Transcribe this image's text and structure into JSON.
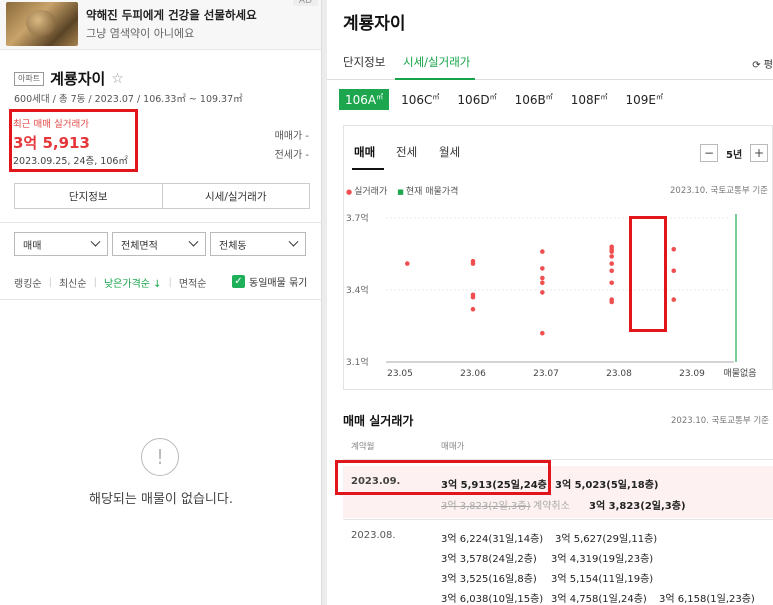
{
  "ad": {
    "title": "약해진 두피에게 건강을 선물하세요",
    "subtitle": "그냥 염색약이 아니에요",
    "badge": "AD"
  },
  "complex": {
    "type_tag": "아파트",
    "name": "계룡자이",
    "star": "☆",
    "info": "600세대 / 총 7동 / 2023.07 / 106.33㎡ ~ 109.37㎡"
  },
  "recent_deal": {
    "label": "최근 매매 실거래가",
    "price": "3억 5,913",
    "detail": "2023.09.25, 24층, 106㎡",
    "sale_label": "매매가 -",
    "jeonse_label": "전세가 -"
  },
  "left_tabs": [
    "단지정보",
    "시세/실거래가"
  ],
  "filters": [
    {
      "value": "매매"
    },
    {
      "value": "전체면적"
    },
    {
      "value": "전체동"
    }
  ],
  "sort": {
    "items": [
      "랭킹순",
      "최신순",
      "낮은가격순 ↓",
      "면적순"
    ],
    "active_index": 2,
    "checkbox_label": "동일매물 묶기",
    "checked": true
  },
  "empty": {
    "icon": "!",
    "message": "해당되는 매물이 없습니다."
  },
  "right": {
    "title": "계룡자이",
    "tabs": [
      "단지정보",
      "시세/실거래가"
    ],
    "active_tab": 1,
    "refresh_label": "⟳ 평",
    "sizes": [
      "106A",
      "106C",
      "106D",
      "106B",
      "108F",
      "109E"
    ],
    "size_unit": "㎡",
    "active_size": 0
  },
  "chart_panel": {
    "tabs": [
      "매매",
      "전세",
      "월세"
    ],
    "active_tab": 0,
    "period": "5년",
    "minus": "−",
    "plus": "+",
    "legend_real": "실거래가",
    "legend_listing": "현재 매물가격",
    "source": "2023.10. 국토교통부 기준"
  },
  "chart_data": {
    "type": "scatter",
    "x_ticks": [
      "23.05",
      "23.06",
      "23.07",
      "23.08",
      "23.09"
    ],
    "extra_x_label": "매물없음",
    "y_ticks": [
      "3.1억",
      "3.4억",
      "3.7억"
    ],
    "y_tick_values": [
      3.1,
      3.4,
      3.7
    ],
    "ylim": [
      3.1,
      3.7
    ],
    "series": [
      {
        "color": "#f04f4f",
        "points": [
          {
            "x": 0.1,
            "y": 3.51
          },
          {
            "x": 1.0,
            "y": 3.52
          },
          {
            "x": 1.0,
            "y": 3.51
          },
          {
            "x": 1.0,
            "y": 3.38
          },
          {
            "x": 1.0,
            "y": 3.37
          },
          {
            "x": 1.0,
            "y": 3.32
          },
          {
            "x": 1.95,
            "y": 3.56
          },
          {
            "x": 1.95,
            "y": 3.49
          },
          {
            "x": 1.95,
            "y": 3.45
          },
          {
            "x": 1.95,
            "y": 3.43
          },
          {
            "x": 1.95,
            "y": 3.39
          },
          {
            "x": 1.95,
            "y": 3.22
          },
          {
            "x": 2.9,
            "y": 3.58
          },
          {
            "x": 2.9,
            "y": 3.57
          },
          {
            "x": 2.9,
            "y": 3.56
          },
          {
            "x": 2.9,
            "y": 3.54
          },
          {
            "x": 2.9,
            "y": 3.51
          },
          {
            "x": 2.9,
            "y": 3.48
          },
          {
            "x": 2.9,
            "y": 3.43
          },
          {
            "x": 2.9,
            "y": 3.36
          },
          {
            "x": 2.9,
            "y": 3.35
          },
          {
            "x": 3.75,
            "y": 3.57
          },
          {
            "x": 3.75,
            "y": 3.48
          },
          {
            "x": 3.75,
            "y": 3.36
          }
        ]
      }
    ],
    "current_marker_color": "#1ea64f"
  },
  "transactions": {
    "title": "매매 실거래가",
    "source": "2023.10. 국토교통부 기준",
    "col_month": "계약월",
    "col_price": "매매가",
    "groups": [
      {
        "month": "2023.09.",
        "lines": [
          [
            {
              "text": "3억 5,913(25일,24층)",
              "style": "b"
            },
            {
              "text": "3억 5,023(5일,18층)",
              "style": "b"
            }
          ],
          [
            {
              "text": "3억 3,823(2일,3층)",
              "style": "strike"
            },
            {
              "text": "계약취소",
              "style": "cancel"
            },
            {
              "text": "3억 3,823(2일,3층)",
              "style": "b"
            }
          ]
        ]
      },
      {
        "month": "2023.08.",
        "lines": [
          [
            {
              "text": "3억 6,224(31일,14층)"
            },
            {
              "text": "3억 5,627(29일,11층)"
            }
          ],
          [
            {
              "text": "3억 3,578(24일,2층)"
            },
            {
              "text": "3억 4,319(19일,23층)"
            }
          ],
          [
            {
              "text": "3억 3,525(16일,8층)"
            },
            {
              "text": "3억 5,154(11일,19층)"
            }
          ],
          [
            {
              "text": "3억 6,038(10일,15층)"
            },
            {
              "text": "3억 4,758(1일,24층)"
            },
            {
              "text": "3억 6,158(1일,23층)"
            }
          ]
        ]
      }
    ]
  }
}
